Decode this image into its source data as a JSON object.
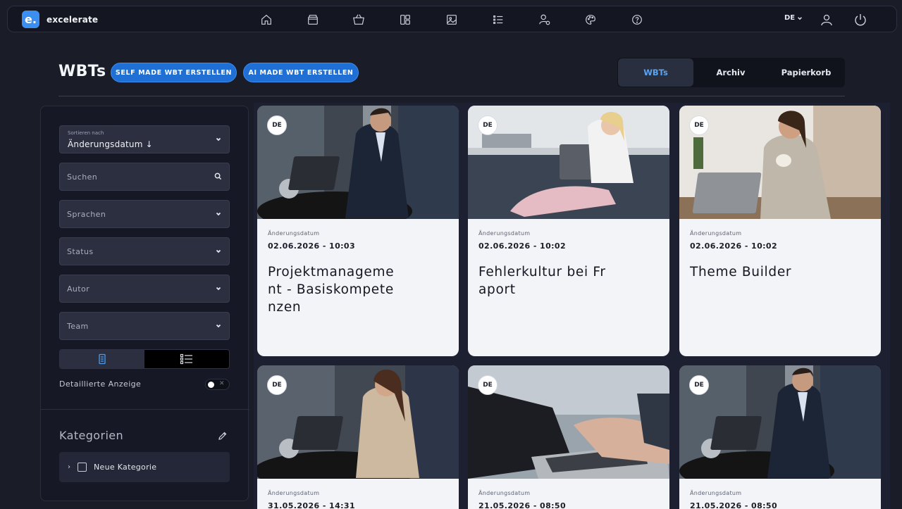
{
  "app": {
    "logo_letter": "e.",
    "name": "excelerate"
  },
  "nav": {
    "icons": [
      "home-icon",
      "archive-box-icon",
      "basket-icon",
      "layout-columns-icon",
      "image-icon",
      "list-icon",
      "user-settings-icon",
      "palette-icon",
      "help-circle-icon"
    ],
    "language": "DE"
  },
  "header": {
    "title": "WBTs",
    "btn_self_made": "SELF MADE WBT ERSTELLEN",
    "btn_ai_made": "AI MADE WBT ERSTELLEN",
    "tabs": [
      {
        "label": "WBTs",
        "active": true
      },
      {
        "label": "Archiv",
        "active": false
      },
      {
        "label": "Papierkorb",
        "active": false
      }
    ]
  },
  "sidebar": {
    "sort_label": "Sortieren nach",
    "sort_value": "Änderungsdatum ↓",
    "search_placeholder": "Suchen",
    "filters": [
      "Sprachen",
      "Status",
      "Autor",
      "Team"
    ],
    "detail_label": "Detaillierte Anzeige",
    "detail_enabled": false,
    "categories_title": "Kategorien",
    "categories": [
      {
        "label": "Neue Kategorie"
      }
    ]
  },
  "cards": [
    {
      "lang": "DE",
      "date_label": "Änderungsdatum",
      "date": "02.06.2026 - 10:03",
      "title": "Projektmanagement - Basiskompetenzen",
      "image": "man in suit working on laptop"
    },
    {
      "lang": "DE",
      "date_label": "Änderungsdatum",
      "date": "02.06.2026 - 10:02",
      "title": "Fehlerkultur bei Fraport",
      "image": "woman on couch with laptop"
    },
    {
      "lang": "DE",
      "date_label": "Änderungsdatum",
      "date": "02.06.2026 - 10:02",
      "title": "Theme Builder",
      "image": "woman with coffee cup at laptop"
    },
    {
      "lang": "DE",
      "date_label": "Änderungsdatum",
      "date": "31.05.2026 - 14:31",
      "title": "",
      "image": "smiling woman at laptop"
    },
    {
      "lang": "DE",
      "date_label": "Änderungsdatum",
      "date": "21.05.2026 - 08:50",
      "title": "",
      "image": "hands typing on laptop"
    },
    {
      "lang": "DE",
      "date_label": "Änderungsdatum",
      "date": "21.05.2026 - 08:50",
      "title": "",
      "image": "man in suit working on laptop"
    }
  ],
  "colors": {
    "accent": "#1f6fd4",
    "active_tab_text": "#5aa3f2",
    "background": "#1a1d28"
  }
}
